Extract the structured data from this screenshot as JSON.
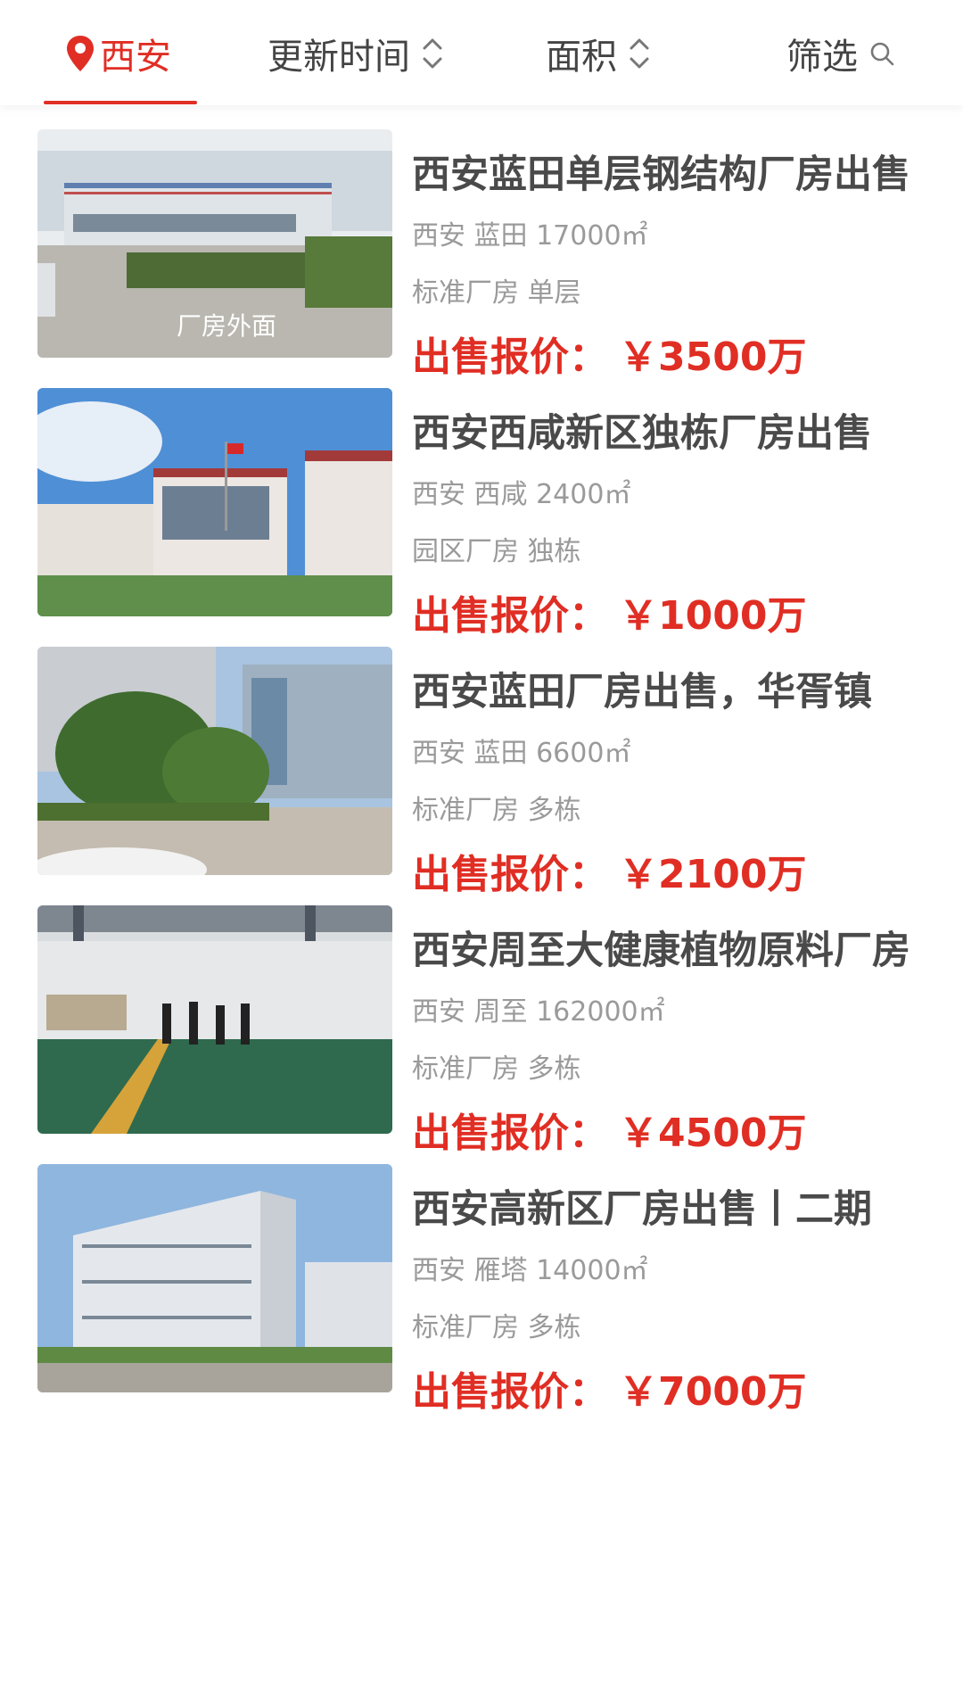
{
  "filters": {
    "city": "西安",
    "update_time": "更新时间",
    "area": "面积",
    "filter": "筛选"
  },
  "listings": [
    {
      "title": "西安蓝田单层钢结构厂房出售",
      "city": "西安",
      "district": "蓝田",
      "size": "17000㎡",
      "type": "标准厂房",
      "floors": "单层",
      "price_label": "出售报价：",
      "price": "￥3500万",
      "image_caption": "厂房外面"
    },
    {
      "title": "西安西咸新区独栋厂房出售",
      "city": "西安",
      "district": "西咸",
      "size": "2400㎡",
      "type": "园区厂房",
      "floors": "独栋",
      "price_label": "出售报价：",
      "price": "￥1000万"
    },
    {
      "title": "西安蓝田厂房出售，华胥镇",
      "city": "西安",
      "district": "蓝田",
      "size": "6600㎡",
      "type": "标准厂房",
      "floors": "多栋",
      "price_label": "出售报价：",
      "price": "￥2100万"
    },
    {
      "title": "西安周至大健康植物原料厂房",
      "city": "西安",
      "district": "周至",
      "size": "162000㎡",
      "type": "标准厂房",
      "floors": "多栋",
      "price_label": "出售报价：",
      "price": "￥4500万"
    },
    {
      "title": "西安高新区厂房出售丨二期",
      "city": "西安",
      "district": "雁塔",
      "size": "14000㎡",
      "type": "标准厂房",
      "floors": "多栋",
      "price_label": "出售报价：",
      "price": "￥7000万"
    }
  ],
  "colors": {
    "accent": "#e02e24",
    "title": "#4a4a4a",
    "meta": "#9a9a9a"
  },
  "icons": {
    "city": "map-pin-icon",
    "sort": "sort-updown-icon",
    "filter": "search-icon"
  }
}
